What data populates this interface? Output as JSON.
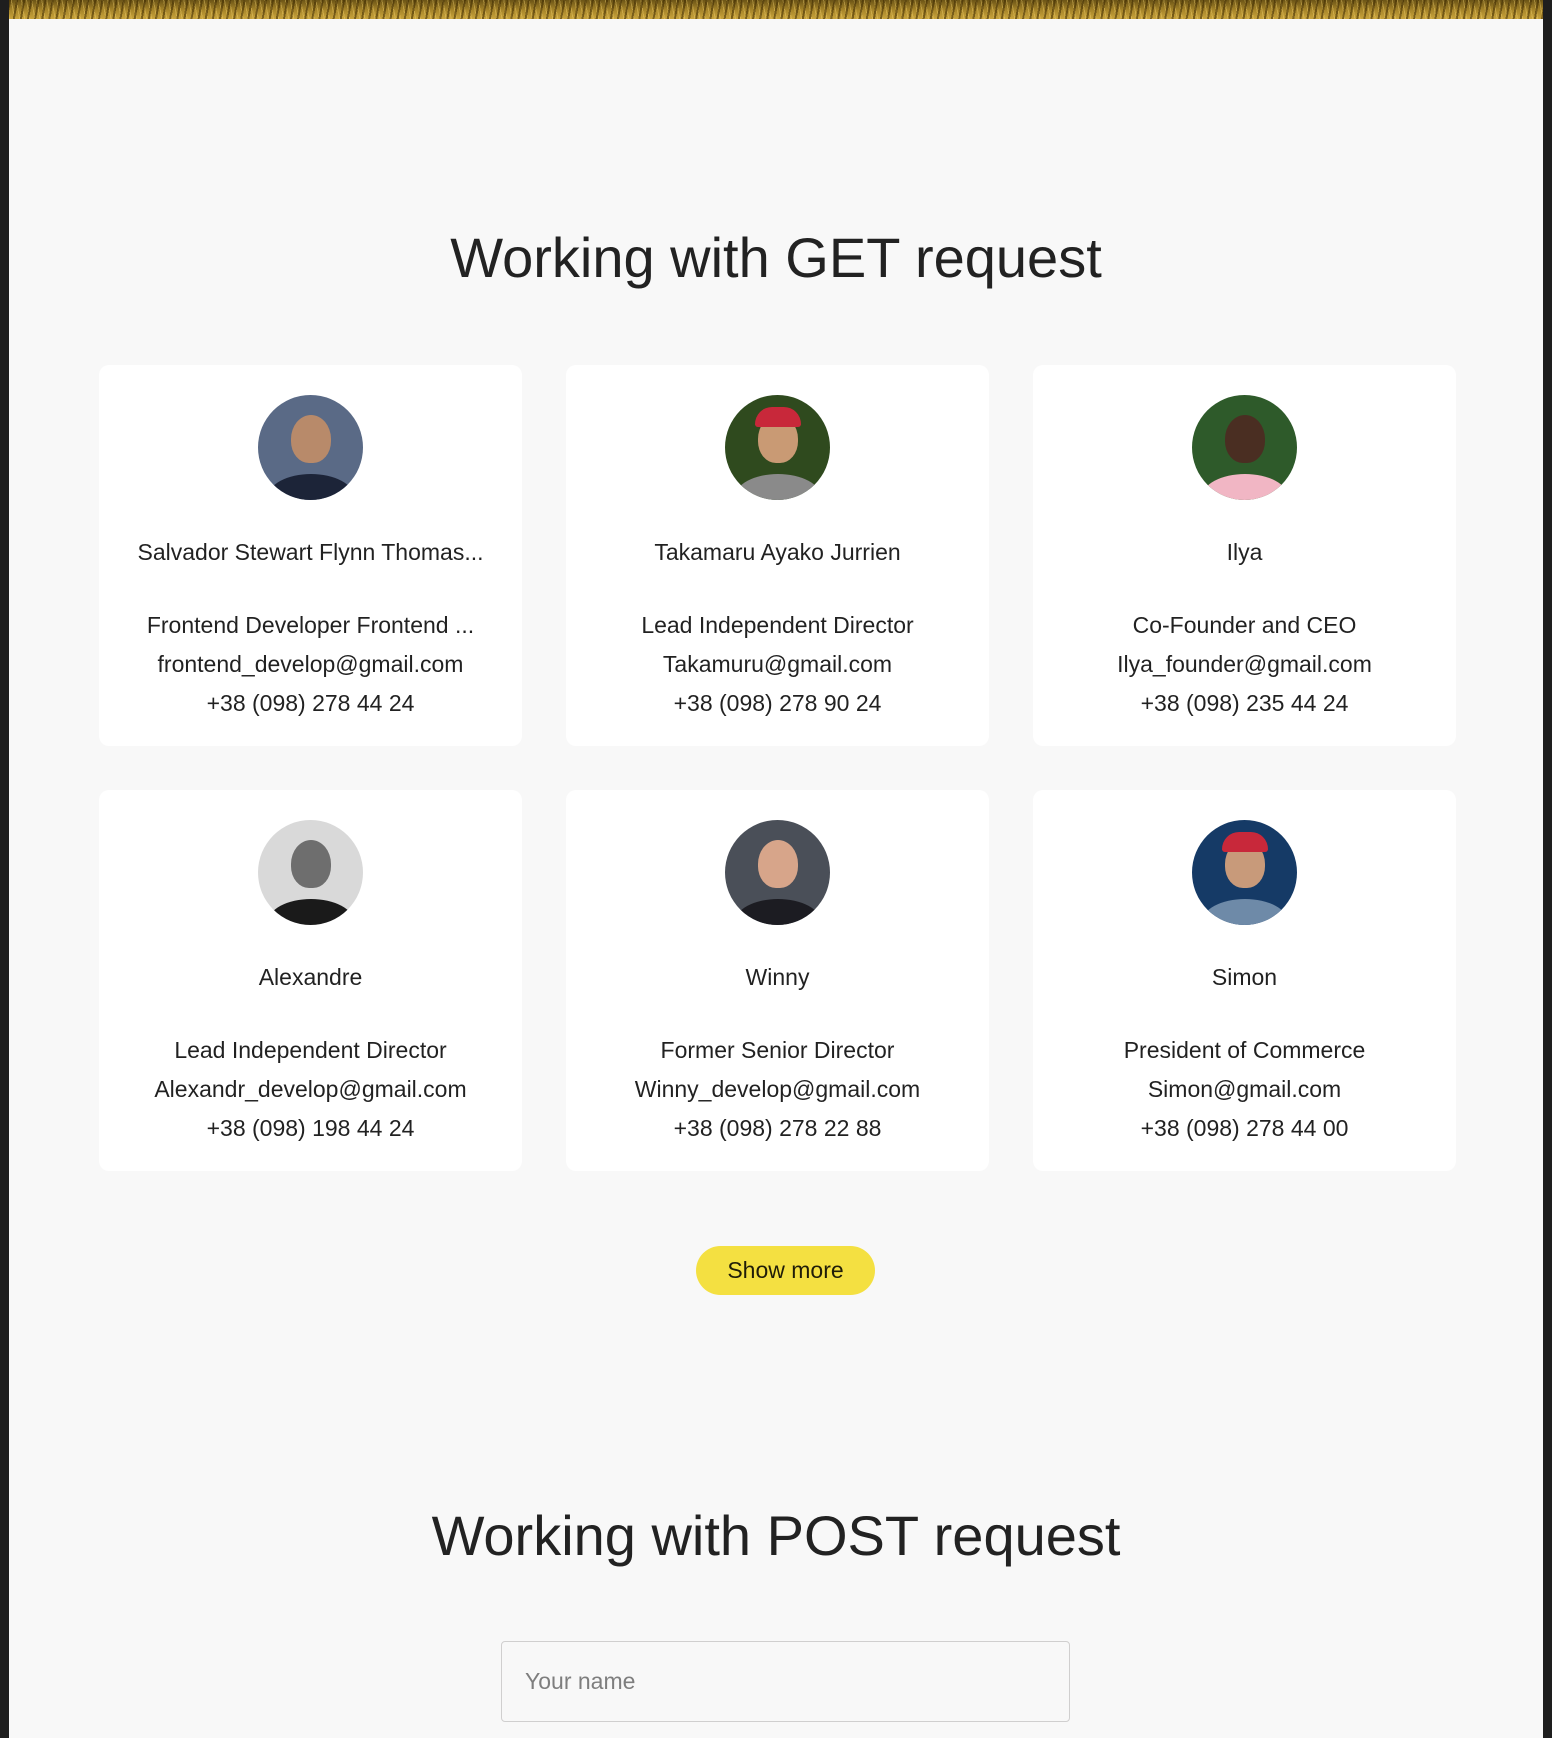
{
  "get_section": {
    "title": "Working with GET request",
    "users": [
      {
        "name": "Salvador Stewart Flynn Thomas...",
        "position": "Frontend Developer Frontend ...",
        "email": "frontend_develop@gmail.com",
        "phone": "+38 (098) 278 44 24",
        "avatar": {
          "bg": "#5a6a86",
          "skin": "#b88a6a",
          "shirt": "#1c2438",
          "cap": false
        }
      },
      {
        "name": "Takamaru Ayako Jurrien",
        "position": "Lead Independent Director",
        "email": "Takamuru@gmail.com",
        "phone": "+38 (098) 278 90 24",
        "avatar": {
          "bg": "#2f4a1e",
          "skin": "#c99a74",
          "shirt": "#8a8a8a",
          "cap": true
        }
      },
      {
        "name": "Ilya",
        "position": "Co-Founder and CEO",
        "email": "Ilya_founder@gmail.com",
        "phone": "+38 (098) 235 44 24",
        "avatar": {
          "bg": "#2e5a2a",
          "skin": "#4a2e22",
          "shirt": "#f1b6c4",
          "cap": false
        }
      },
      {
        "name": "Alexandre",
        "position": "Lead Independent Director",
        "email": "Alexandr_develop@gmail.com",
        "phone": "+38 (098) 198 44 24",
        "avatar": {
          "bg": "#d9d9d9",
          "skin": "#6e6e6e",
          "shirt": "#1a1a1a",
          "cap": false
        }
      },
      {
        "name": "Winny",
        "position": "Former Senior Director",
        "email": "Winny_develop@gmail.com",
        "phone": "+38 (098) 278 22 88",
        "avatar": {
          "bg": "#4a4f58",
          "skin": "#d7a58a",
          "shirt": "#1c1c22",
          "cap": false
        }
      },
      {
        "name": "Simon",
        "position": "President of Commerce",
        "email": "Simon@gmail.com",
        "phone": "+38 (098) 278 44 00",
        "avatar": {
          "bg": "#153a66",
          "skin": "#c89a7a",
          "shirt": "#6e8aa8",
          "cap": true
        }
      }
    ],
    "show_more_label": "Show more"
  },
  "post_section": {
    "title": "Working with POST request",
    "name_field": {
      "placeholder": "Your name",
      "value": ""
    }
  },
  "colors": {
    "accent": "#f4e041",
    "page_bg": "#f8f8f8",
    "card_bg": "#ffffff"
  }
}
